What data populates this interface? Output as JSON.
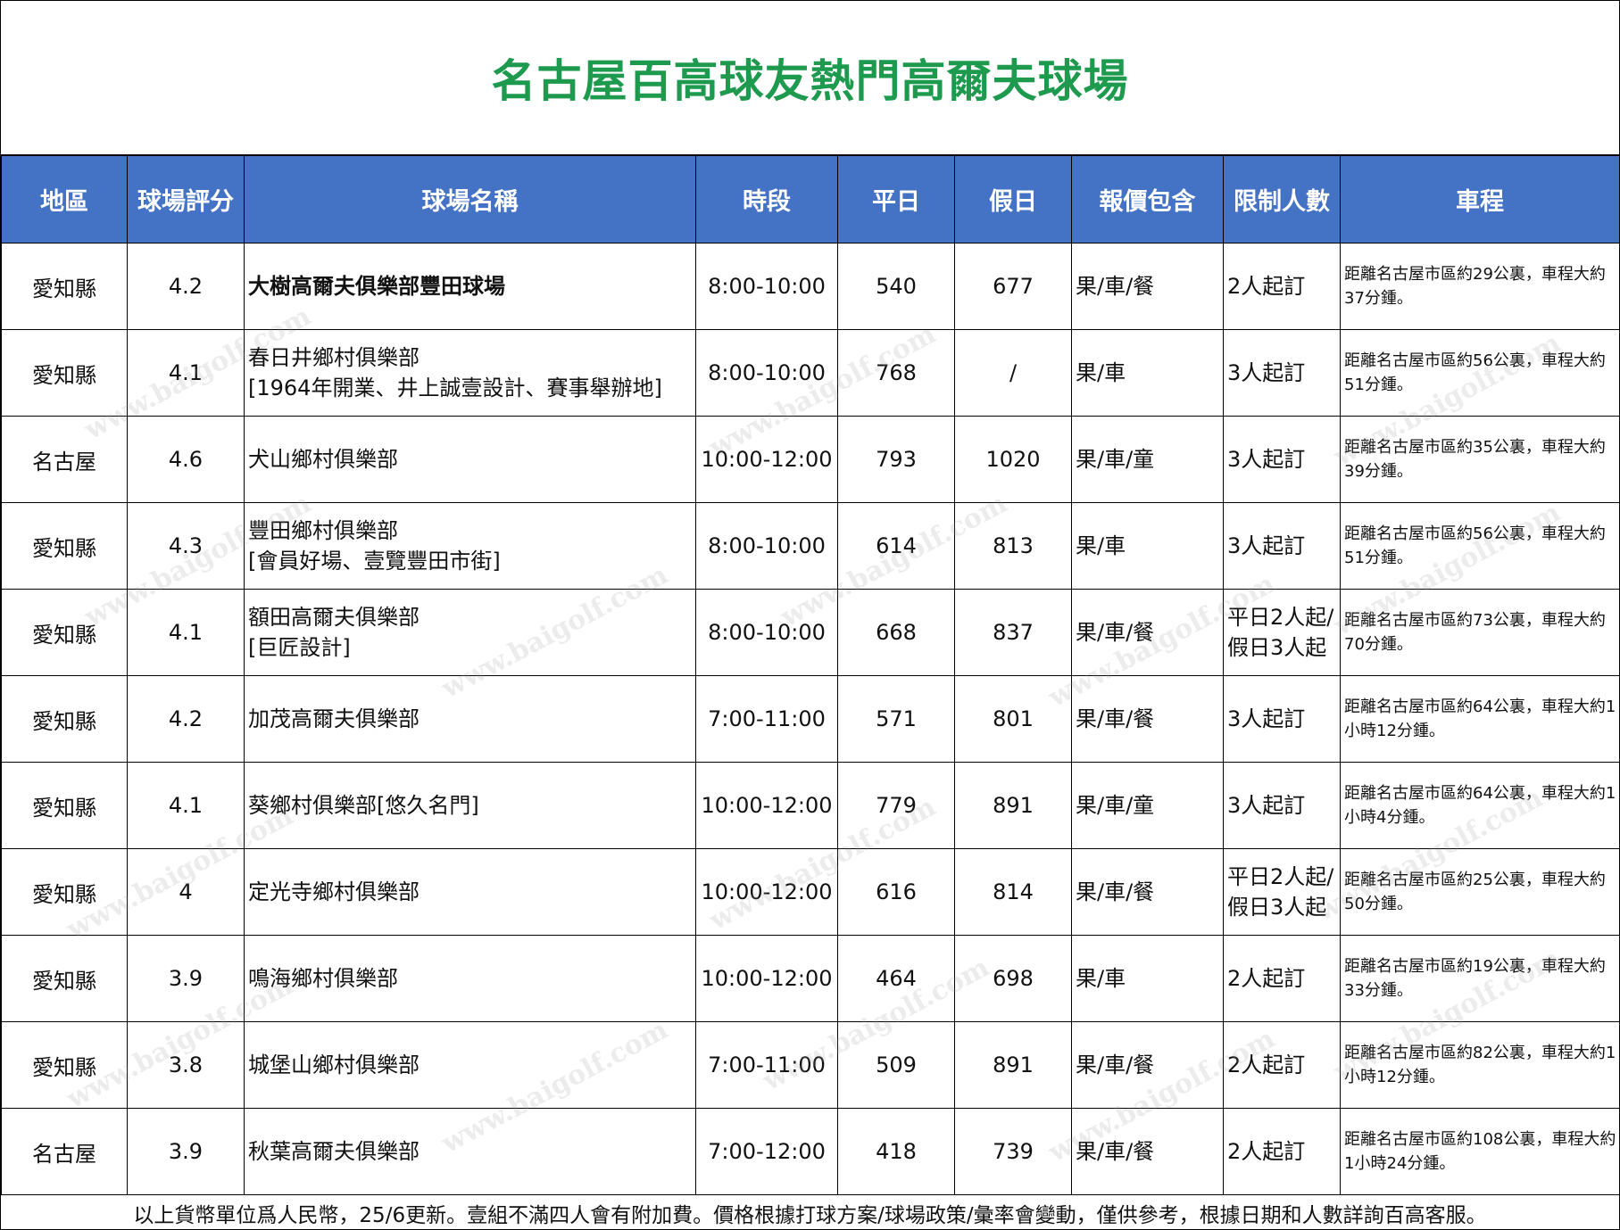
{
  "title": "名古屋百高球友熱門高爾夫球場",
  "columns": [
    "地區",
    "球場評分",
    "球場名稱",
    "時段",
    "平日",
    "假日",
    "報價包含",
    "限制人數",
    "車程"
  ],
  "rows": [
    {
      "region": "愛知縣",
      "rating": "4.2",
      "name_line1": "大樹高爾夫俱樂部豐田球場",
      "name_line2": "",
      "time": "8:00-10:00",
      "weekday": "540",
      "holiday": "677",
      "includes": "果/車/餐",
      "limit_line1": "2人起訂",
      "limit_line2": "",
      "distance": "距離名古屋市區約29公裏，車程大約37分鍾。"
    },
    {
      "region": "愛知縣",
      "rating": "4.1",
      "name_line1": "春日井鄉村俱樂部",
      "name_line2": "[1964年開業、井上誠壹設計、賽事舉辦地]",
      "time": "8:00-10:00",
      "weekday": "768",
      "holiday": "/",
      "includes": "果/車",
      "limit_line1": "3人起訂",
      "limit_line2": "",
      "distance": "距離名古屋市區約56公裏，車程大約51分鍾。"
    },
    {
      "region": "名古屋",
      "rating": "4.6",
      "name_line1": "犬山鄉村俱樂部",
      "name_line2": "",
      "time": "10:00-12:00",
      "weekday": "793",
      "holiday": "1020",
      "includes": "果/車/童",
      "limit_line1": "3人起訂",
      "limit_line2": "",
      "distance": "距離名古屋市區約35公裏，車程大約39分鍾。"
    },
    {
      "region": "愛知縣",
      "rating": "4.3",
      "name_line1": "豐田鄉村俱樂部",
      "name_line2": "[會員好場、壹覽豐田市街]",
      "time": "8:00-10:00",
      "weekday": "614",
      "holiday": "813",
      "includes": "果/車",
      "limit_line1": "3人起訂",
      "limit_line2": "",
      "distance": "距離名古屋市區約56公裏，車程大約51分鍾。"
    },
    {
      "region": "愛知縣",
      "rating": "4.1",
      "name_line1": "額田高爾夫俱樂部",
      "name_line2": "[巨匠設計]",
      "time": "8:00-10:00",
      "weekday": "668",
      "holiday": "837",
      "includes": "果/車/餐",
      "limit_line1": "平日2人起/",
      "limit_line2": "假日3人起",
      "distance": "距離名古屋市區約73公裏，車程大約70分鍾。"
    },
    {
      "region": "愛知縣",
      "rating": "4.2",
      "name_line1": "加茂高爾夫俱樂部",
      "name_line2": "",
      "time": "7:00-11:00",
      "weekday": "571",
      "holiday": "801",
      "includes": "果/車/餐",
      "limit_line1": "3人起訂",
      "limit_line2": "",
      "distance": "距離名古屋市區約64公裏，車程大約1小時12分鍾。"
    },
    {
      "region": "愛知縣",
      "rating": "4.1",
      "name_line1": "葵鄉村俱樂部[悠久名門]",
      "name_line2": "",
      "time": "10:00-12:00",
      "weekday": "779",
      "holiday": "891",
      "includes": "果/車/童",
      "limit_line1": "3人起訂",
      "limit_line2": "",
      "distance": "距離名古屋市區約64公裏，車程大約1小時4分鍾。"
    },
    {
      "region": "愛知縣",
      "rating": "4",
      "name_line1": "定光寺鄉村俱樂部",
      "name_line2": "",
      "time": "10:00-12:00",
      "weekday": "616",
      "holiday": "814",
      "includes": "果/車/餐",
      "limit_line1": "平日2人起/",
      "limit_line2": "假日3人起",
      "distance": "距離名古屋市區約25公裏，車程大約50分鍾。"
    },
    {
      "region": "愛知縣",
      "rating": "3.9",
      "name_line1": "鳴海鄉村俱樂部",
      "name_line2": "",
      "time": "10:00-12:00",
      "weekday": "464",
      "holiday": "698",
      "includes": "果/車",
      "limit_line1": "2人起訂",
      "limit_line2": "",
      "distance": "距離名古屋市區約19公裏，車程大約33分鍾。"
    },
    {
      "region": "愛知縣",
      "rating": "3.8",
      "name_line1": "城堡山鄉村俱樂部",
      "name_line2": "",
      "time": "7:00-11:00",
      "weekday": "509",
      "holiday": "891",
      "includes": "果/車/餐",
      "limit_line1": "2人起訂",
      "limit_line2": "",
      "distance": "距離名古屋市區約82公裏，車程大約1小時12分鍾。"
    },
    {
      "region": "名古屋",
      "rating": "3.9",
      "name_line1": "秋葉高爾夫俱樂部",
      "name_line2": "",
      "time": "7:00-12:00",
      "weekday": "418",
      "holiday": "739",
      "includes": "果/車/餐",
      "limit_line1": "2人起訂",
      "limit_line2": "",
      "distance": "距離名古屋市區約108公裏，車程大約1小時24分鍾。"
    }
  ],
  "footer": "以上貨幣單位爲人民幣，25/6更新。壹組不滿四人會有附加費。價格根據打球方案/球場政策/彙率會變動，僅供參考，根據日期和人數詳詢百高客服。",
  "watermark": "www.baigolf.com",
  "colors": {
    "title": "#1e9a4f",
    "header_bg": "#4472c4",
    "header_text": "#ffffff"
  }
}
